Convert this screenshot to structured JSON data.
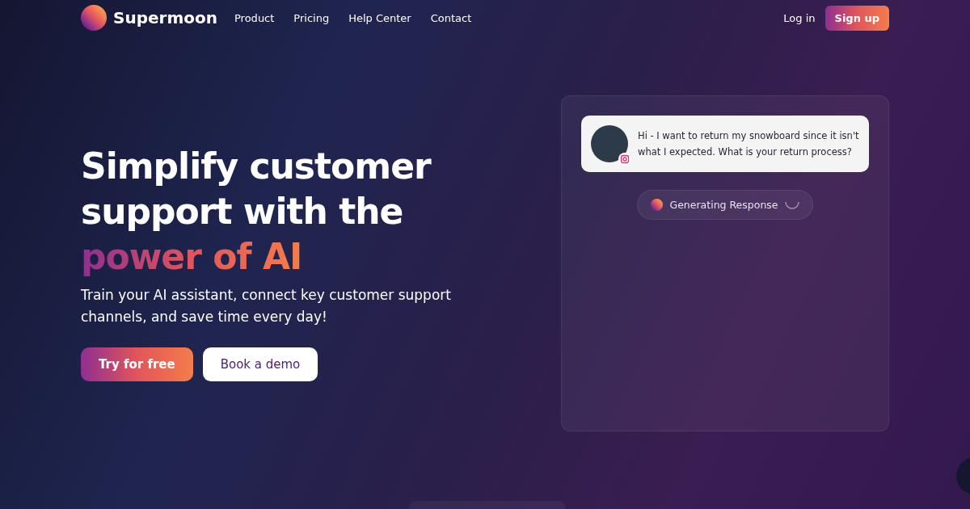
{
  "brand": {
    "name": "Supermoon"
  },
  "nav": [
    {
      "label": "Product"
    },
    {
      "label": "Pricing"
    },
    {
      "label": "Help Center"
    },
    {
      "label": "Contact"
    }
  ],
  "auth": {
    "login": "Log in",
    "signup": "Sign up"
  },
  "hero": {
    "title_lines": [
      "Simplify customer",
      "support with the"
    ],
    "highlight": "power of AI",
    "subtitle": "Train your AI assistant, connect key customer support channels, and save time every day!",
    "buttons": [
      {
        "label": "Try for free",
        "kind": "primary"
      },
      {
        "label": "Book a demo",
        "kind": "secondary"
      }
    ]
  },
  "chat": {
    "message": "Hi - I want to return my snowboard since it isn't what I expected. What is your return process?",
    "status": "Generating Response"
  }
}
